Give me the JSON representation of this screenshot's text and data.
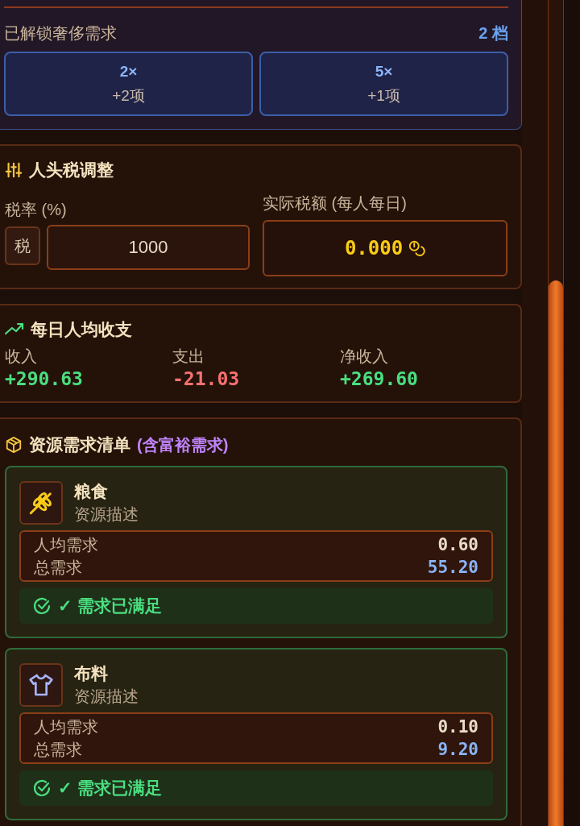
{
  "luxury": {
    "label": "已解锁奢侈需求",
    "count": "2 档",
    "tiers": [
      {
        "multiplier": "2×",
        "items": "+2项"
      },
      {
        "multiplier": "5×",
        "items": "+1项"
      }
    ]
  },
  "tax": {
    "title": "人头税调整",
    "rate_label": "税率 (%)",
    "rate_badge": "税",
    "rate_value": "1000",
    "actual_label": "实际税额 (每人每日)",
    "actual_value": "0.000"
  },
  "balance": {
    "title": "每日人均收支",
    "stats": [
      {
        "label": "收入",
        "value": "+290.63",
        "kind": "positive"
      },
      {
        "label": "支出",
        "value": "-21.03",
        "kind": "negative"
      },
      {
        "label": "净收入",
        "value": "+269.60",
        "kind": "positive"
      }
    ]
  },
  "resources": {
    "title": "资源需求清单",
    "subtitle": "(含富裕需求)",
    "items": [
      {
        "kind": "grain",
        "name": "粮食",
        "description": "资源描述",
        "per_capita_label": "人均需求",
        "per_capita": "0.60",
        "total_label": "总需求",
        "total": "55.20",
        "status": "✓ 需求已满足",
        "satisfied": true
      },
      {
        "kind": "cloth",
        "name": "布料",
        "description": "资源描述",
        "per_capita_label": "人均需求",
        "per_capita": "0.10",
        "total_label": "总需求",
        "total": "9.20",
        "status": "✓ 需求已满足",
        "satisfied": true
      }
    ]
  }
}
